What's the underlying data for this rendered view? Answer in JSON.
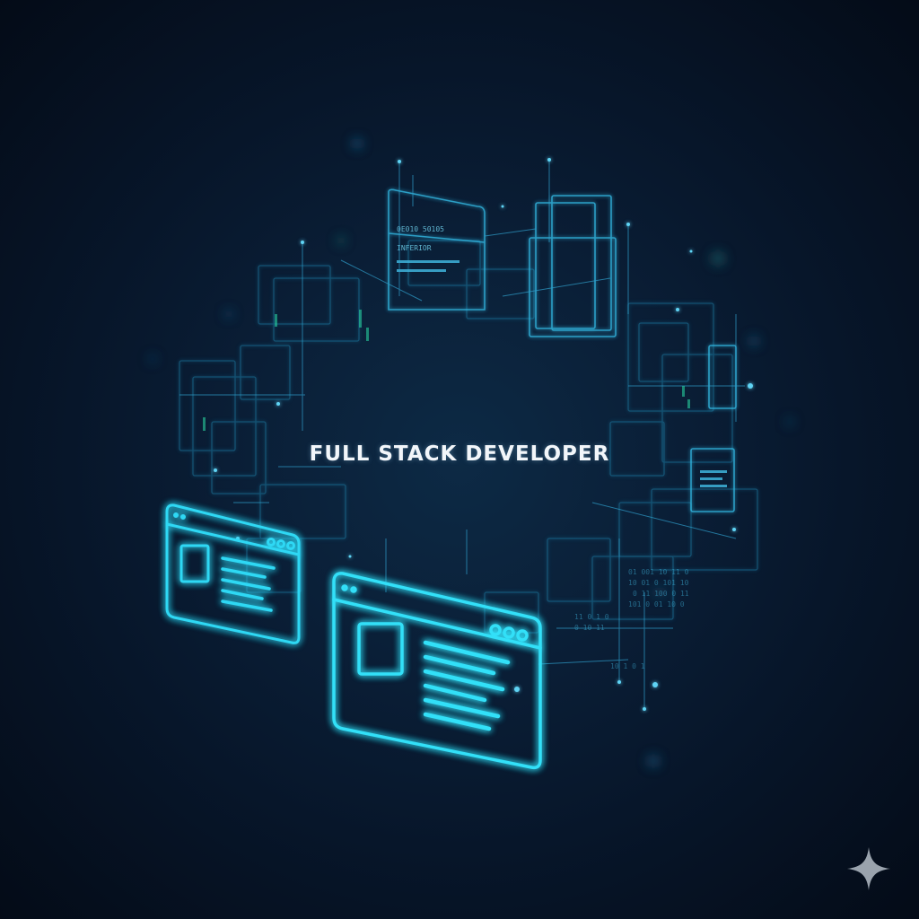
{
  "headline": "FULL STACK DEVELOPER",
  "palette": {
    "background": "#07162a",
    "glow": "#22d3f0",
    "wire": "#3fb4dc",
    "dim_wire": "#1d6f95",
    "accent_green": "#2be0a8",
    "text": "#f2f6fa",
    "sparkle": "#9aa3ad"
  },
  "icons": [
    "browser-window-icon",
    "code-lines-icon",
    "sparkle-icon"
  ]
}
